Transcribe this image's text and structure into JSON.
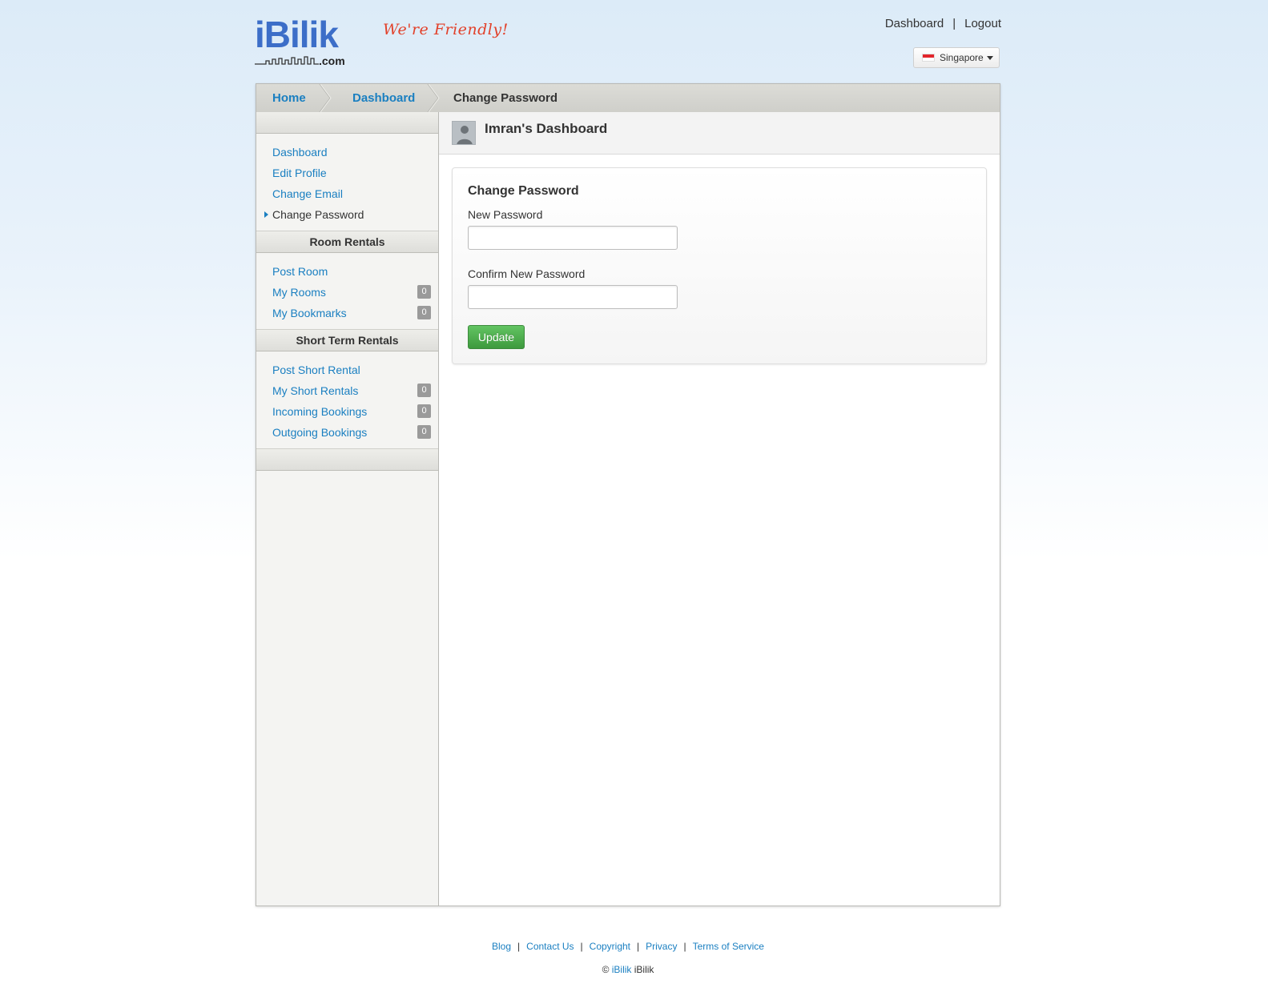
{
  "header": {
    "logo_text": "iBilik",
    "logo_suffix": ".com",
    "tagline": "We're Friendly!",
    "links": {
      "dashboard": "Dashboard",
      "separator": "|",
      "logout": "Logout"
    },
    "country": "Singapore"
  },
  "breadcrumb": {
    "home": "Home",
    "dashboard": "Dashboard",
    "current": "Change Password"
  },
  "sidebar": {
    "account_items": [
      {
        "label": "Dashboard"
      },
      {
        "label": "Edit Profile"
      },
      {
        "label": "Change Email"
      },
      {
        "label": "Change Password",
        "active": true
      }
    ],
    "room_rentals": {
      "heading": "Room Rentals",
      "items": [
        {
          "label": "Post Room"
        },
        {
          "label": "My Rooms",
          "count": "0"
        },
        {
          "label": "My Bookmarks",
          "count": "0"
        }
      ]
    },
    "short_term": {
      "heading": "Short Term Rentals",
      "items": [
        {
          "label": "Post Short Rental"
        },
        {
          "label": "My Short Rentals",
          "count": "0"
        },
        {
          "label": "Incoming Bookings",
          "count": "0"
        },
        {
          "label": "Outgoing Bookings",
          "count": "0"
        }
      ]
    }
  },
  "dashboard": {
    "title": "Imran's Dashboard"
  },
  "form": {
    "title": "Change Password",
    "new_password_label": "New Password",
    "new_password_value": "",
    "confirm_label": "Confirm New Password",
    "confirm_value": "",
    "submit_label": "Update"
  },
  "footer": {
    "links": [
      "Blog",
      "Contact Us",
      "Copyright",
      "Privacy",
      "Terms of Service"
    ],
    "separator": "|",
    "copyright_symbol": "©",
    "copyright_brand": "iBilik",
    "copyright_text": "iBilik"
  },
  "colors": {
    "link": "#1a7fc1",
    "brand": "#3c6ec8",
    "tagline": "#e2412a",
    "update_button": "#4cae4c",
    "badge": "#9a9a9a"
  }
}
